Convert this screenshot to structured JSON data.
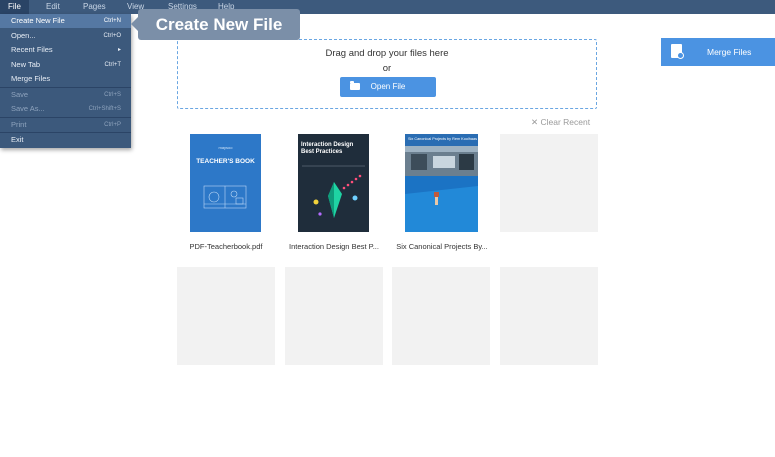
{
  "menubar": {
    "items": [
      "File",
      "Edit",
      "Pages",
      "View",
      "Settings",
      "Help"
    ]
  },
  "file_menu": {
    "items": [
      {
        "label": "Create New File",
        "shortcut": "Ctrl+N",
        "state": "highlighted"
      },
      {
        "label": "Open...",
        "shortcut": "Ctrl+O",
        "state": "enabled"
      },
      {
        "label": "Recent Files",
        "shortcut": "▸",
        "state": "enabled"
      },
      {
        "label": "New Tab",
        "shortcut": "Ctrl+T",
        "state": "enabled"
      },
      {
        "label": "Merge Files",
        "shortcut": "",
        "state": "enabled"
      },
      {
        "label": "Save",
        "shortcut": "Ctrl+S",
        "state": "disabled"
      },
      {
        "label": "Save As...",
        "shortcut": "Ctrl+Shift+S",
        "state": "disabled"
      },
      {
        "label": "Print",
        "shortcut": "Ctrl+P",
        "state": "disabled"
      },
      {
        "label": "Exit",
        "shortcut": "",
        "state": "enabled"
      }
    ]
  },
  "tooltip": {
    "text": "Create New File"
  },
  "dropzone": {
    "line1": "Drag and drop your files here",
    "line2": "or",
    "open_label": "Open File"
  },
  "merge": {
    "label": "Merge Files"
  },
  "recent": {
    "clear_label": "✕  Clear Recent"
  },
  "files": [
    {
      "name": "PDF-Teacherbook.pdf",
      "cover_brand": "maysoo",
      "cover_title": "TEACHER'S BOOK"
    },
    {
      "name": "Interaction Design Best P...",
      "cover_title": "Interaction Design Best Practices"
    },
    {
      "name": "Six Canonical Projects By...",
      "cover_title": "Six Canonical Projects by Rem Koolhaas"
    }
  ],
  "colors": {
    "menubar": "#3d5a7d",
    "accent": "#4b93e2",
    "tooltip": "#7b8fa8",
    "tile": "#f2f2f2"
  }
}
